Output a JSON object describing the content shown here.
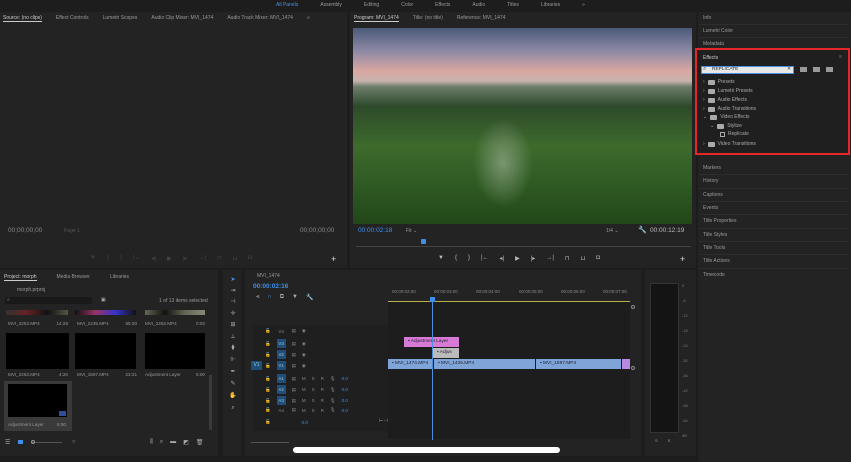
{
  "workspaces": [
    "All Panels",
    "Assembly",
    "Editing",
    "Color",
    "Effects",
    "Audio",
    "Titles",
    "Libraries"
  ],
  "workspace_more": "»",
  "source": {
    "tabs": [
      "Source: (no clips)",
      "Effect Controls",
      "Lumetri Scopes",
      "Audio Clip Mixer: MVI_1474",
      "Audio Track Mixer: MVI_1474"
    ],
    "more": "»",
    "timecode_left": "00;00;00;00",
    "page": "Page 1",
    "timecode_right": "00;00;00;00"
  },
  "program": {
    "tabs": [
      "Program: MVI_1474",
      "Title: (no title)",
      "Reference: MVI_1474"
    ],
    "timecode": "00:00:02:18",
    "fit": "Fit",
    "resolution": "1/4",
    "duration": "00:00:12:19",
    "playhead_fraction": 0.2
  },
  "right_panel": {
    "top": [
      "Info",
      "Lumetri Color",
      "Metadata"
    ],
    "effects": {
      "title": "Effects",
      "search": "REPLICATE",
      "tree": [
        {
          "label": "Presets",
          "level": 0
        },
        {
          "label": "Lumetri Presets",
          "level": 0
        },
        {
          "label": "Audio Effects",
          "level": 0
        },
        {
          "label": "Audio Transitions",
          "level": 0
        },
        {
          "label": "Video Effects",
          "level": 0,
          "open": true
        },
        {
          "label": "Stylize",
          "level": 1,
          "open": true
        },
        {
          "label": "Replicate",
          "level": 2
        },
        {
          "label": "Video Transitions",
          "level": 0
        }
      ]
    },
    "bottom": [
      "Markers",
      "History",
      "Captions",
      "Events",
      "Title Properties",
      "Title Styles",
      "Title Tools",
      "Title Actions",
      "Timecode"
    ]
  },
  "project": {
    "tabs": [
      "Project: morph",
      "Media Browser",
      "Libraries"
    ],
    "file": "morph.prproj",
    "selection": "1 of 13 items selected",
    "items": [
      {
        "name": "MVI_2253.MP4",
        "dur": "14:26"
      },
      {
        "name": "MVI_2235.MP4",
        "dur": "55:30"
      },
      {
        "name": "MVI_2262.MP4",
        "dur": "0:02"
      },
      {
        "name": "MVI_2263.MP4",
        "dur": "4:20"
      },
      {
        "name": "MVI_1597.MP4",
        "dur": "23:21"
      },
      {
        "name": "Adjustment Layer",
        "dur": "5:00"
      },
      {
        "name": "Adjustment Layer",
        "dur": "5:00"
      }
    ]
  },
  "timeline": {
    "tab": "MVI_1474",
    "timecode": "00:00:02:16",
    "ruler": [
      "00:00:02:00",
      "00:00:03:00",
      "00:00:04:00",
      "00:00:05:00",
      "00:00:06:00",
      "00:00:07:00"
    ],
    "video_tracks": [
      "V4",
      "V3",
      "V2",
      "V1"
    ],
    "source_patch": "V1",
    "audio_tracks": [
      "A1",
      "A2",
      "A3",
      "A4"
    ],
    "audio_level": "0.0",
    "master_level": "0.0",
    "msr": [
      "M",
      "S",
      "R"
    ],
    "clips": {
      "adj1": "Adjustment Layer",
      "adj2": "Adjus",
      "v1a": "MVI_1474.MP4",
      "v1b": "MVI_1426.MP4",
      "v1c": "MVI_1597.MP4"
    }
  },
  "meter": {
    "scale": [
      "0",
      "-6",
      "-12",
      "-18",
      "-24",
      "-30",
      "-36",
      "-42",
      "-48",
      "-54",
      "dB"
    ],
    "solo": [
      "S",
      "S"
    ]
  },
  "colors": {
    "accent": "#3f8fe8",
    "highlight": "#e5262b",
    "clip_video": "#7ea4d8",
    "clip_adjust": "#d77ad6"
  }
}
